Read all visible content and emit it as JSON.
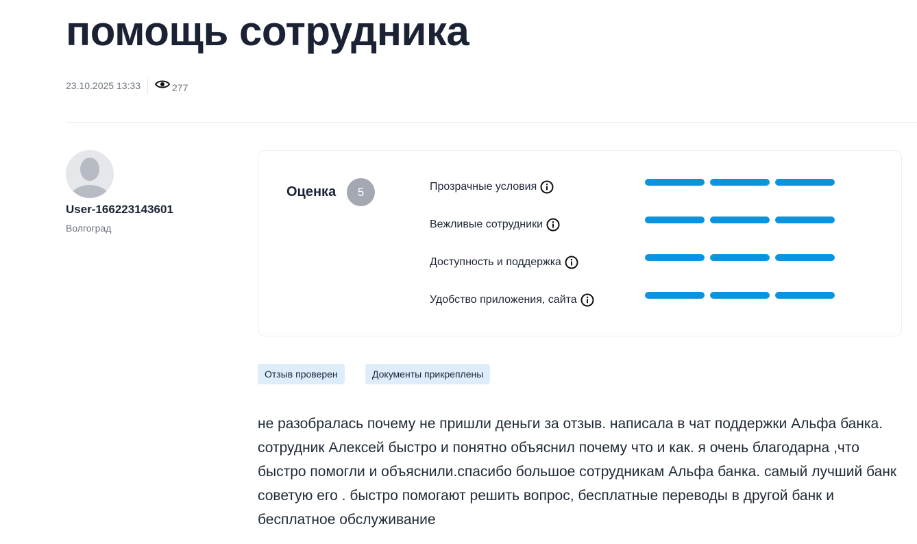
{
  "review": {
    "title": "помощь сотрудника",
    "date": "23.10.2025 13:33",
    "views": "277",
    "text": "не разобралась почему не пришли деньги за отзыв. написала в чат поддержки Альфа банка. сотрудник Алексей быстро и понятно объяснил почему что и как. я очень благодарна ,что быстро помогли и объяснили.спасибо большое сотрудникам Альфа банка. самый лучший банк советую его . быстро помогают решить вопрос, бесплатные переводы в другой банк и бесплатное обслуживание"
  },
  "user": {
    "name": "User-166223143601",
    "city": "Волгоград"
  },
  "rating": {
    "label": "Оценка",
    "value": "5",
    "criteria": [
      {
        "label": "Прозрачные условия",
        "score": 3,
        "max": 3
      },
      {
        "label": "Вежливые сотрудники",
        "score": 3,
        "max": 3
      },
      {
        "label": "Доступность и поддержка",
        "score": 3,
        "max": 3
      },
      {
        "label": "Удобство приложения, сайта",
        "score": 3,
        "max": 3
      }
    ]
  },
  "tags": [
    "Отзыв проверен",
    "Документы прикреплены"
  ],
  "colors": {
    "bar": "#0a94e0",
    "badge": "#a4a8b3",
    "tag_bg": "#ddeefa"
  },
  "icons": {
    "views": "eye-icon",
    "criterion_info": "info-icon",
    "avatar": "user-avatar-placeholder"
  }
}
